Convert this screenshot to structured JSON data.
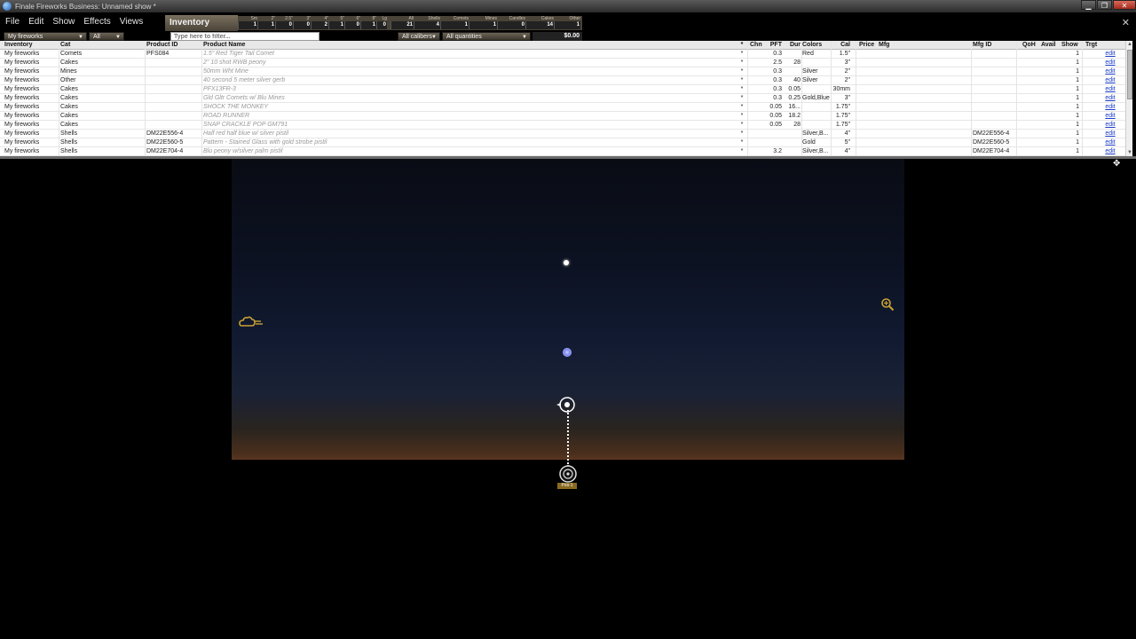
{
  "window": {
    "title": "Finale Fireworks Business: Unnamed show *",
    "buttons": {
      "minimize": "▁",
      "maximize": "❐",
      "close": "✕"
    }
  },
  "menu": [
    "File",
    "Edit",
    "Show",
    "Effects",
    "Views"
  ],
  "panel": {
    "tab_label": "Inventory",
    "close_glyph": "✕"
  },
  "stats": [
    {
      "label": "Sm",
      "value": "1"
    },
    {
      "label": "2\"",
      "value": "1"
    },
    {
      "label": "2.5\"",
      "value": "0"
    },
    {
      "label": "3\"",
      "value": "0"
    },
    {
      "label": "4\"",
      "value": "2"
    },
    {
      "label": "5\"",
      "value": "1"
    },
    {
      "label": "6\"",
      "value": "0"
    },
    {
      "label": "8\"",
      "value": "1"
    },
    {
      "label": "Lg",
      "value": "0"
    },
    {
      "label": "All",
      "value": "21"
    },
    {
      "label": "Shells",
      "value": "4"
    },
    {
      "label": "Comets",
      "value": "1"
    },
    {
      "label": "Mines",
      "value": "1"
    },
    {
      "label": "Candles",
      "value": "0"
    },
    {
      "label": "Cakes",
      "value": "14"
    },
    {
      "label": "Other",
      "value": "1"
    }
  ],
  "filters": {
    "inventory_select": "My fireworks",
    "category_select": "All",
    "filter_placeholder": "Type here to filter...",
    "calibers_select": "All calibers",
    "quantities_select": "All quantities",
    "total": "$0.00"
  },
  "table": {
    "columns": {
      "inventory": "Inventory",
      "cat": "Cat",
      "product_id": "Product ID",
      "product_name": "Product Name",
      "star": "*",
      "chn": "Chn",
      "pft": "PFT",
      "dur": "Dur",
      "colors": "Colors",
      "cal": "Cal",
      "price": "Price",
      "mfg": "Mfg",
      "mfg_id": "Mfg ID",
      "qoh": "QoH",
      "avail": "Avail",
      "show": "Show",
      "trgt": "Trgt"
    },
    "rows": [
      {
        "inventory": "My fireworks",
        "cat": "Comets",
        "product_id": "PFS084",
        "product_name": "1.5\" Red Tiger Tail Comet",
        "star": "*",
        "pft": "0.3",
        "dur": "",
        "colors": "Red",
        "cal": "1.5\"",
        "mfg_id": "",
        "show": "1",
        "edit": "edit"
      },
      {
        "inventory": "My fireworks",
        "cat": "Cakes",
        "product_id": "",
        "product_name": "2\" 10 shot RWB peony",
        "star": "*",
        "pft": "2.5",
        "dur": "28",
        "colors": "",
        "cal": "3\"",
        "mfg_id": "",
        "show": "1",
        "edit": "edit"
      },
      {
        "inventory": "My fireworks",
        "cat": "Mines",
        "product_id": "",
        "product_name": "50mm Wht Mine",
        "star": "*",
        "pft": "0.3",
        "dur": "",
        "colors": "Silver",
        "cal": "2\"",
        "mfg_id": "",
        "show": "1",
        "edit": "edit"
      },
      {
        "inventory": "My fireworks",
        "cat": "Other",
        "product_id": "",
        "product_name": "40 second 5 meter silver gerb",
        "star": "*",
        "pft": "0.3",
        "dur": "40",
        "colors": "Silver",
        "cal": "2\"",
        "mfg_id": "",
        "show": "1",
        "edit": "edit"
      },
      {
        "inventory": "My fireworks",
        "cat": "Cakes",
        "product_id": "",
        "product_name": "PFX13FR-3",
        "star": "*",
        "pft": "0.3",
        "dur": "0.05",
        "colors": "",
        "cal": "30mm",
        "mfg_id": "",
        "show": "1",
        "edit": "edit"
      },
      {
        "inventory": "My fireworks",
        "cat": "Cakes",
        "product_id": "",
        "product_name": "Gld Gltr Comets w/ Blu Mines",
        "star": "*",
        "pft": "0.3",
        "dur": "0.25",
        "colors": "Gold,Blue",
        "cal": "3\"",
        "mfg_id": "",
        "show": "1",
        "edit": "edit"
      },
      {
        "inventory": "My fireworks",
        "cat": "Cakes",
        "product_id": "",
        "product_name": "SHOCK THE MONKEY",
        "star": "*",
        "pft": "0.05",
        "dur": "16...",
        "colors": "",
        "cal": "1.75\"",
        "mfg_id": "",
        "show": "1",
        "edit": "edit"
      },
      {
        "inventory": "My fireworks",
        "cat": "Cakes",
        "product_id": "",
        "product_name": "ROAD RUNNER",
        "star": "*",
        "pft": "0.05",
        "dur": "18.2",
        "colors": "",
        "cal": "1.75\"",
        "mfg_id": "",
        "show": "1",
        "edit": "edit"
      },
      {
        "inventory": "My fireworks",
        "cat": "Cakes",
        "product_id": "",
        "product_name": "SNAP CRACKLE POP GM791",
        "star": "*",
        "pft": "0.05",
        "dur": "28",
        "colors": "",
        "cal": "1.75\"",
        "mfg_id": "",
        "show": "1",
        "edit": "edit"
      },
      {
        "inventory": "My fireworks",
        "cat": "Shells",
        "product_id": "DM22E556-4",
        "product_name": "Half red half blue w/ silver pistil",
        "star": "*",
        "pft": "",
        "dur": "",
        "colors": "Silver,B...",
        "cal": "4\"",
        "mfg_id": "DM22E556-4",
        "show": "1",
        "edit": "edit"
      },
      {
        "inventory": "My fireworks",
        "cat": "Shells",
        "product_id": "DM22E560-5",
        "product_name": "Pattern - Stained Glass with gold strobe pistil",
        "star": "*",
        "pft": "",
        "dur": "",
        "colors": "Gold",
        "cal": "5\"",
        "mfg_id": "DM22E560-5",
        "show": "1",
        "edit": "edit"
      },
      {
        "inventory": "My fireworks",
        "cat": "Shells",
        "product_id": "DM22E704-4",
        "product_name": "Blu peony w/silver palm pistil",
        "star": "*",
        "pft": "3.2",
        "dur": "",
        "colors": "Silver,B...",
        "cal": "4\"",
        "mfg_id": "DM22E704-4",
        "show": "1",
        "edit": "edit"
      }
    ]
  },
  "scrollbar": {
    "up": "▲",
    "down": "▼"
  },
  "resize_glyph": "✥",
  "viewport": {
    "position_label": "Pos-1"
  }
}
